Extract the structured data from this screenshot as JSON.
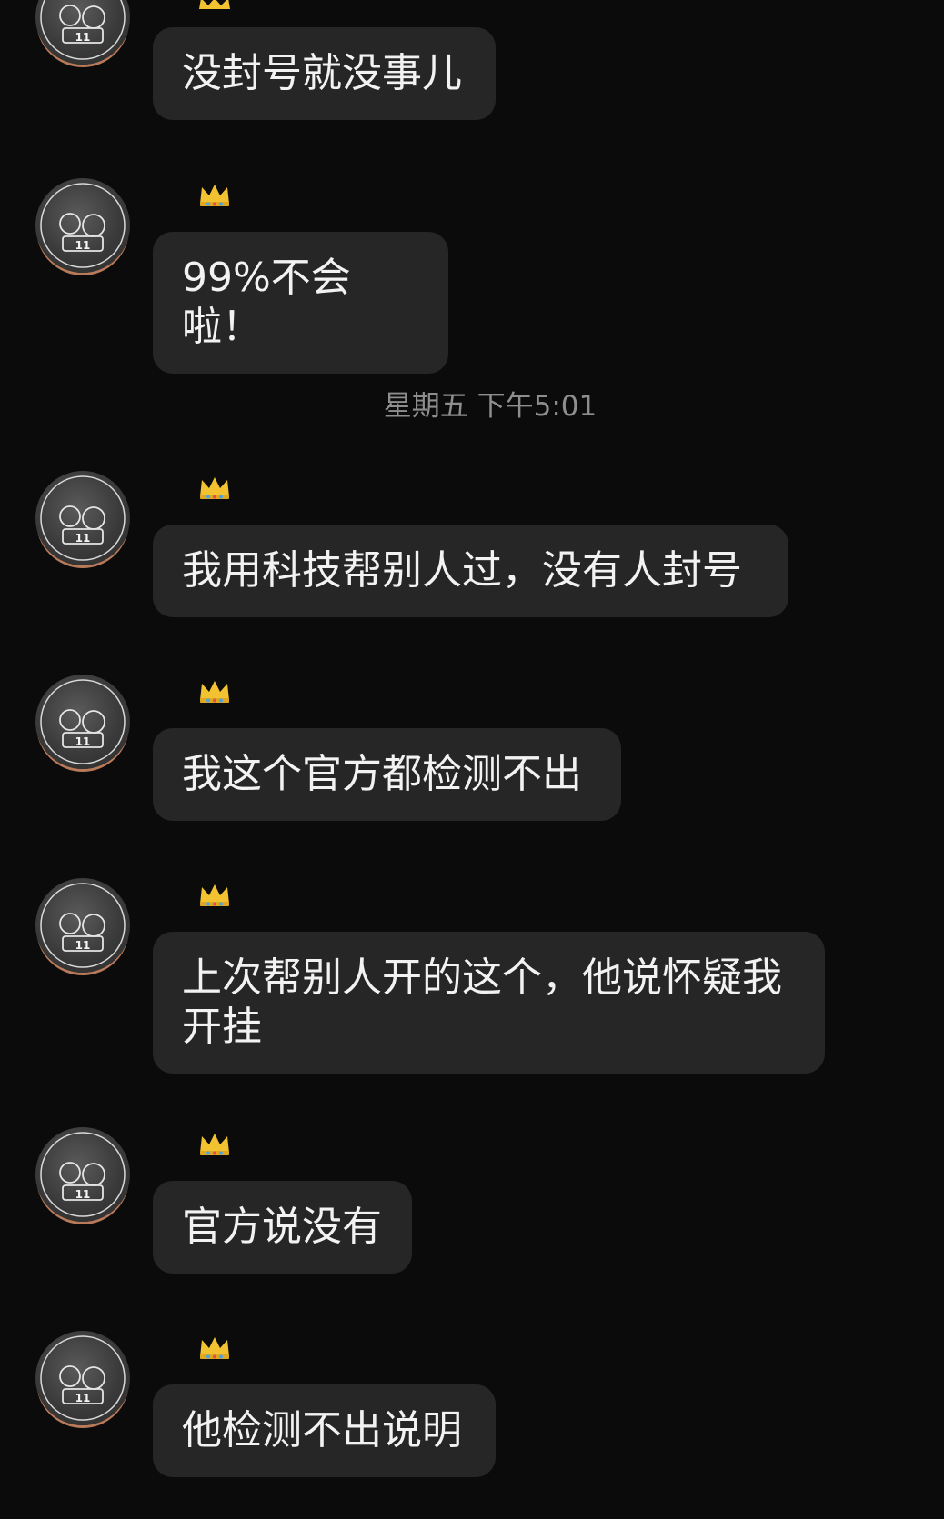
{
  "timestamp": "星期五 下午5:01",
  "messages": [
    {
      "text": "没封号就没事儿"
    },
    {
      "text": "99%不会啦！"
    },
    {
      "text": "我用科技帮别人过，没有人封号"
    },
    {
      "text": "我这个官方都检测不出"
    },
    {
      "text": "上次帮别人开的这个，他说怀疑我开挂"
    },
    {
      "text": "官方说没有"
    },
    {
      "text": "他检测不出说明"
    }
  ],
  "avatar": {
    "badge_number": "11"
  },
  "colors": {
    "background": "#0b0b0b",
    "bubble": "#262626",
    "text": "#f2f2f2",
    "timestamp": "#8e8e8e",
    "crown": "#f2c230"
  }
}
